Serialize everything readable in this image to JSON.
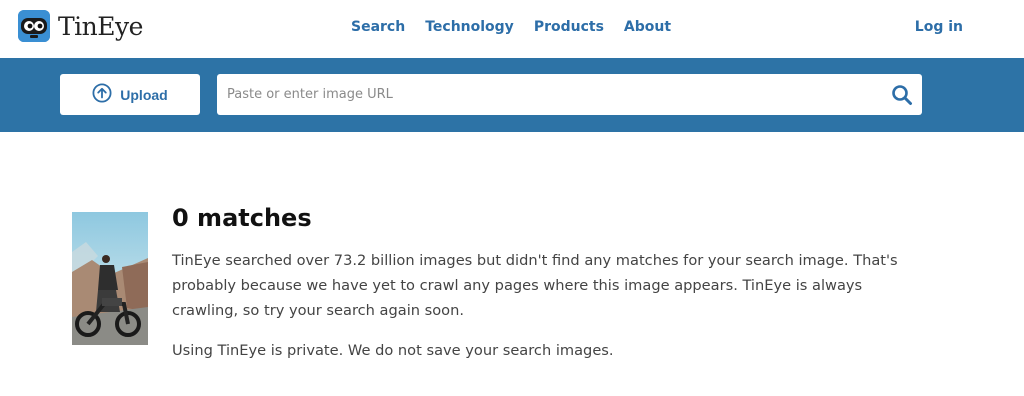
{
  "header": {
    "logo_text": "TinEye",
    "nav": [
      {
        "label": "Search"
      },
      {
        "label": "Technology"
      },
      {
        "label": "Products"
      },
      {
        "label": "About"
      }
    ],
    "login_label": "Log in"
  },
  "search": {
    "upload_label": "Upload",
    "url_placeholder": "Paste or enter image URL",
    "url_value": ""
  },
  "result": {
    "title": "0 matches",
    "description": "TinEye searched over 73.2 billion images but didn't find any matches for your search image. That's probably because we have yet to crawl any pages where this image appears. TinEye is always crawling, so try your search again soon.",
    "privacy_note": "Using TinEye is private. We do not save your search images."
  },
  "icons": {
    "upload": "upload-arrow-icon",
    "search": "search-icon",
    "logo": "tineye-robot-icon"
  },
  "colors": {
    "accent": "#2d6ea8",
    "searchbar_bg": "#2d73a6"
  }
}
